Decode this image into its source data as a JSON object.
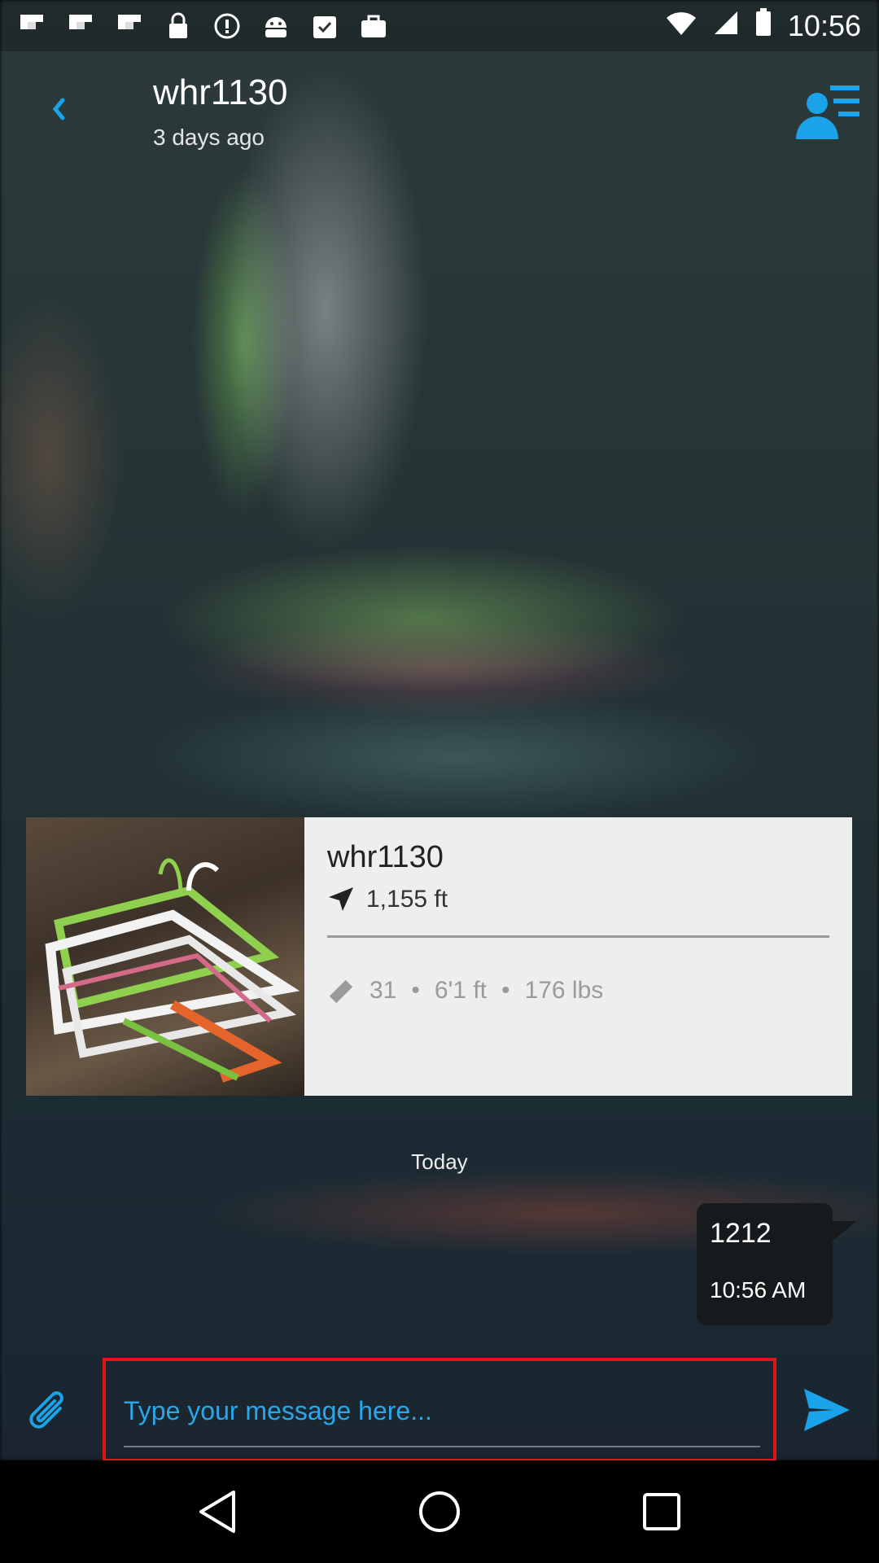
{
  "status_bar": {
    "time": "10:56",
    "icons": [
      "flipboard-icon",
      "flipboard-icon",
      "flipboard-icon",
      "lock-icon",
      "alert-icon",
      "android-icon",
      "clipboard-check-icon",
      "briefcase-icon"
    ],
    "wifi": "wifi-icon",
    "signal": "signal-icon",
    "battery": "battery-icon"
  },
  "header": {
    "title": "whr1130",
    "subtitle": "3 days ago"
  },
  "profile_card": {
    "name": "whr1130",
    "distance": "1,155 ft",
    "age": "31",
    "height": "6'1 ft",
    "weight": "176 lbs",
    "separator": "•"
  },
  "conversation": {
    "day_label": "Today",
    "messages": [
      {
        "text": "1212",
        "time": "10:56 AM"
      }
    ]
  },
  "composer": {
    "placeholder": "Type your message here..."
  },
  "colors": {
    "accent": "#1aa3e8",
    "highlight_border": "#e0141a"
  }
}
